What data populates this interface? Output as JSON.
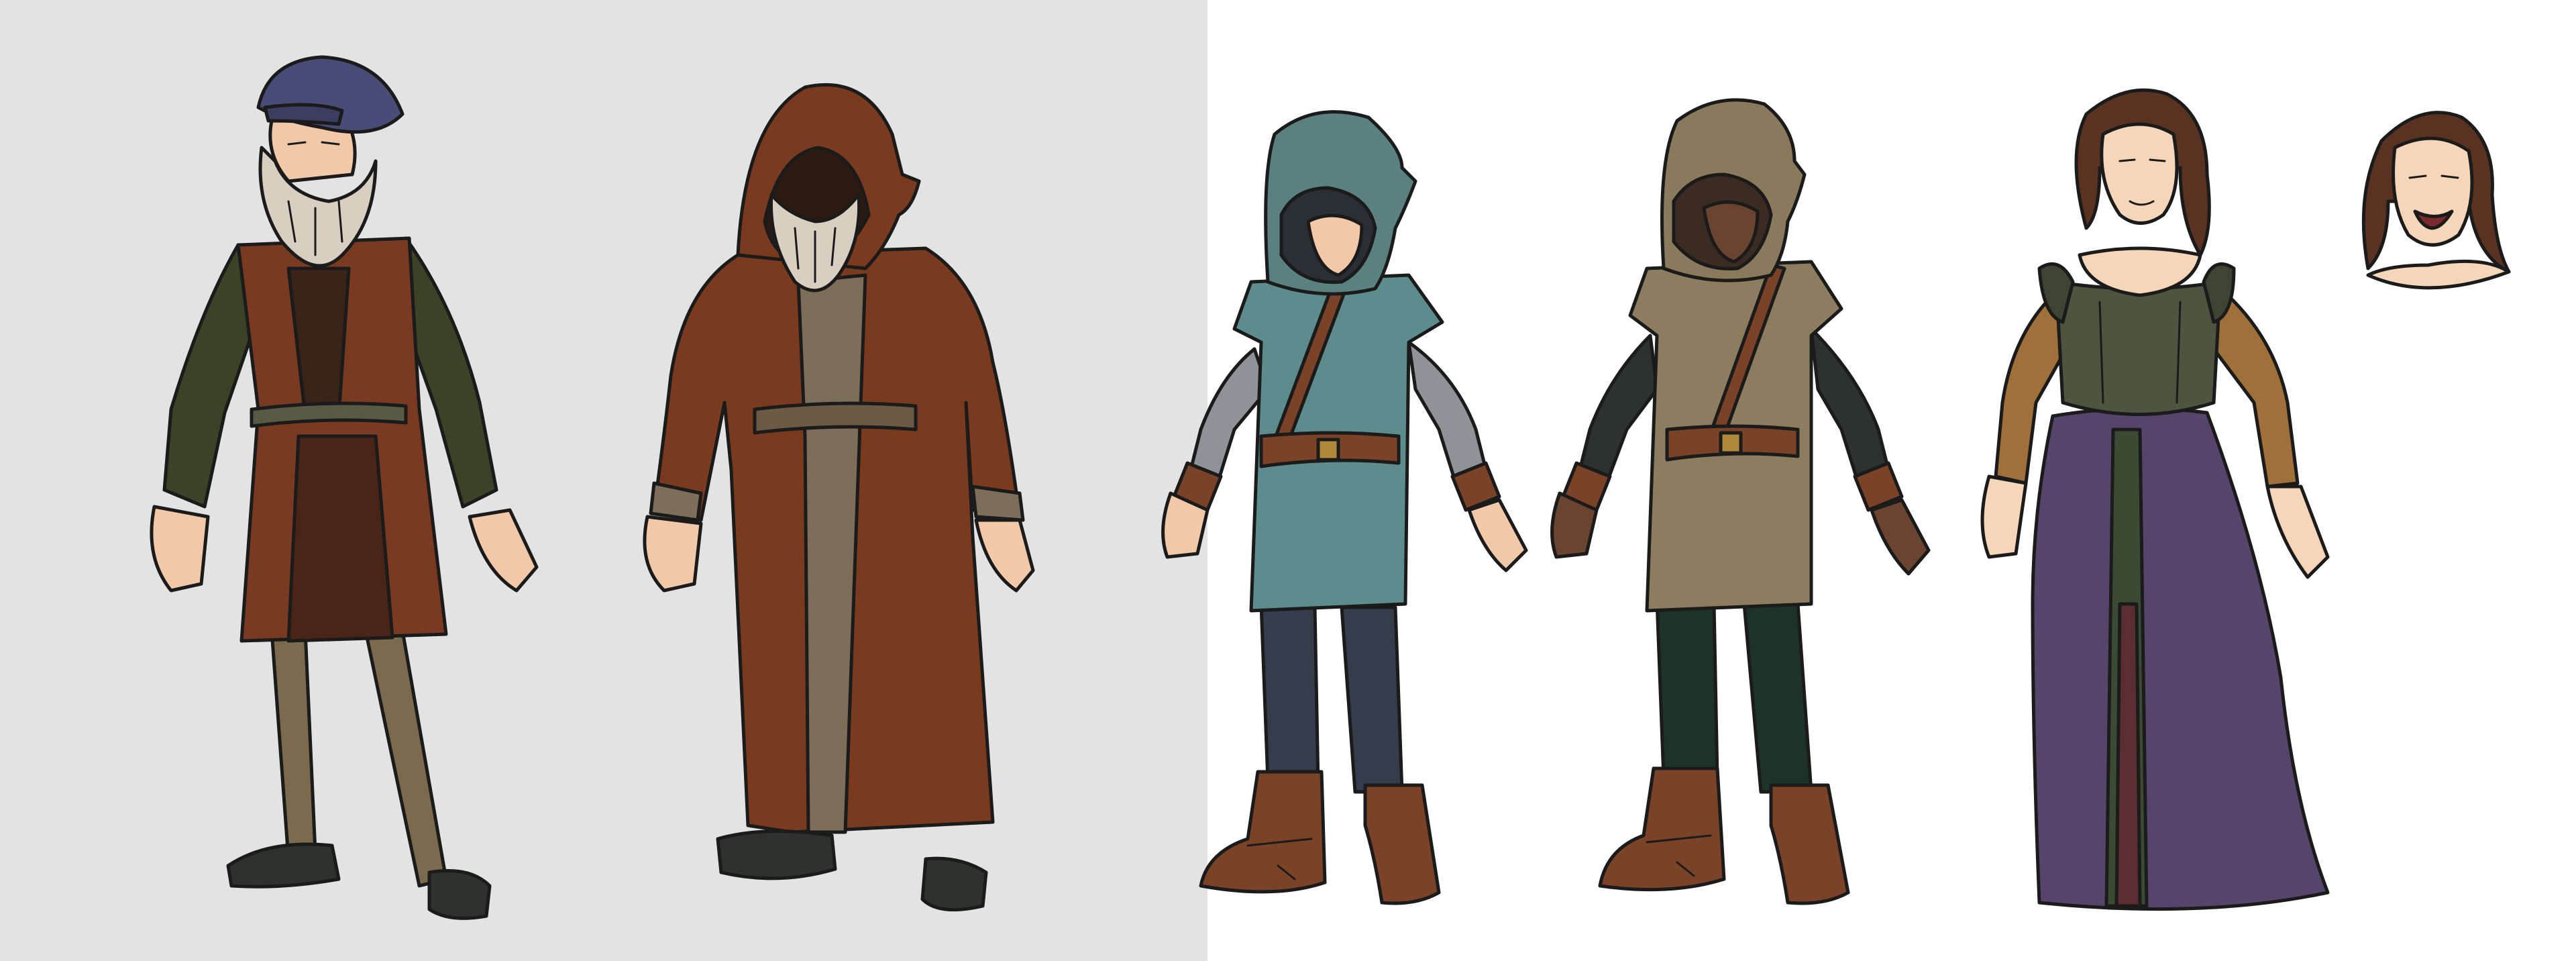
{
  "sheet": {
    "panels": [
      "gray-background",
      "white-background"
    ],
    "characters": [
      {
        "role": "bearded-scholar",
        "colors": {
          "hat": "#4a4c78",
          "tunic": "#7a3a22",
          "sleeves": "#3a4326",
          "legs": "#7b6a4c",
          "shoes": "#2f312f",
          "beard": "#d8cfc2"
        }
      },
      {
        "role": "hooded-monk",
        "colors": {
          "robe": "#7a3a1e",
          "lining": "#7d6e5a",
          "beard": "#d8cfc2",
          "shoes": "#2f312f"
        }
      },
      {
        "role": "teal-hooded-traveler",
        "colors": {
          "hood": "#5a8080",
          "tunic": "#5d8c8c",
          "sleeves": "#8f9398",
          "legs": "#363d4a",
          "boots": "#7a4226",
          "belt": "#7a4226"
        }
      },
      {
        "role": "olive-hooded-traveler",
        "colors": {
          "hood": "#8a7a5c",
          "tunic": "#8c7d5e",
          "sleeves": "#2b3230",
          "legs": "#1e3328",
          "boots": "#7a4226",
          "belt": "#7a4226"
        }
      },
      {
        "role": "renaissance-woman",
        "colors": {
          "hair": "#5a3222",
          "bodice": "#4d5440",
          "sleeves": "#a0703a",
          "skirt": "#56456a",
          "underskirt": "#3a4a34"
        }
      },
      {
        "role": "woman-portrait-head",
        "colors": {
          "hair": "#5a3222",
          "skin": "#f5d6b8"
        }
      }
    ]
  }
}
